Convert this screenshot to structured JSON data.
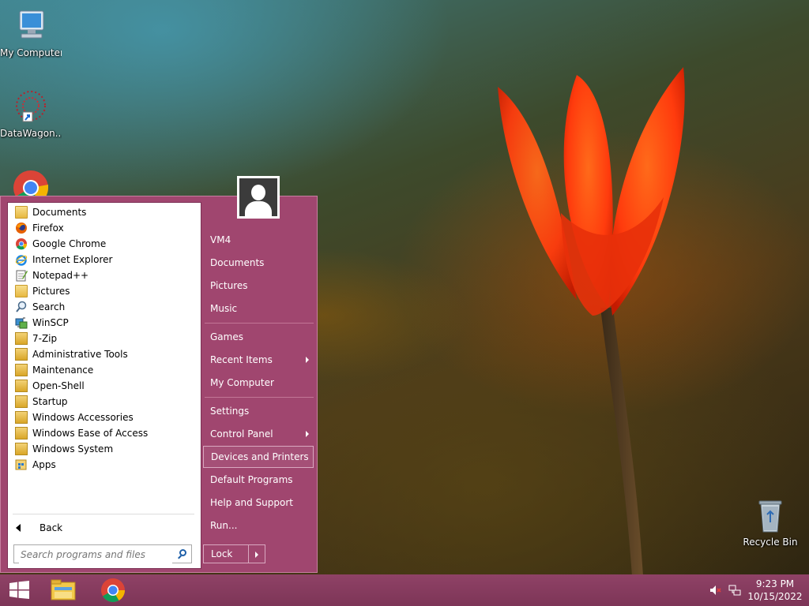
{
  "desktop": {
    "icons": [
      {
        "label": "My Computer",
        "icon": "computer-icon"
      },
      {
        "label": "DataWagon...",
        "icon": "shortcut-icon"
      },
      {
        "label": "",
        "icon": "chrome-icon"
      },
      {
        "label": "Recycle Bin",
        "icon": "recycle-bin-icon"
      }
    ]
  },
  "start_menu": {
    "programs": [
      {
        "label": "Documents",
        "icon": "documents-icon"
      },
      {
        "label": "Firefox",
        "icon": "firefox-icon"
      },
      {
        "label": "Google Chrome",
        "icon": "chrome-icon"
      },
      {
        "label": "Internet Explorer",
        "icon": "ie-icon"
      },
      {
        "label": "Notepad++",
        "icon": "notepad-icon"
      },
      {
        "label": "Pictures",
        "icon": "pictures-icon"
      },
      {
        "label": "Search",
        "icon": "search-icon"
      },
      {
        "label": "WinSCP",
        "icon": "winscp-icon"
      },
      {
        "label": "7-Zip",
        "icon": "folder-icon"
      },
      {
        "label": "Administrative Tools",
        "icon": "folder-icon"
      },
      {
        "label": "Maintenance",
        "icon": "folder-icon"
      },
      {
        "label": "Open-Shell",
        "icon": "folder-icon"
      },
      {
        "label": "Startup",
        "icon": "folder-icon"
      },
      {
        "label": "Windows Accessories",
        "icon": "folder-icon"
      },
      {
        "label": "Windows Ease of Access",
        "icon": "folder-icon"
      },
      {
        "label": "Windows System",
        "icon": "folder-icon"
      },
      {
        "label": "Apps",
        "icon": "apps-icon"
      }
    ],
    "back_label": "Back",
    "search_placeholder": "Search programs and files",
    "right_items": [
      {
        "label": "VM4"
      },
      {
        "label": "Documents"
      },
      {
        "label": "Pictures"
      },
      {
        "label": "Music"
      },
      {
        "label": "Games"
      },
      {
        "label": "Recent Items",
        "submenu": true
      },
      {
        "label": "My Computer"
      },
      {
        "label": "Settings"
      },
      {
        "label": "Control Panel",
        "submenu": true
      },
      {
        "label": "Devices and Printers",
        "highlighted": true
      },
      {
        "label": "Default Programs"
      },
      {
        "label": "Help and Support"
      },
      {
        "label": "Run..."
      }
    ],
    "lock_label": "Lock"
  },
  "taskbar": {
    "pinned": [
      "file-explorer-icon",
      "chrome-icon"
    ],
    "time": "9:23 PM",
    "date": "10/15/2022"
  },
  "colors": {
    "accent": "#a0466f",
    "taskbar": "#8f4266"
  }
}
